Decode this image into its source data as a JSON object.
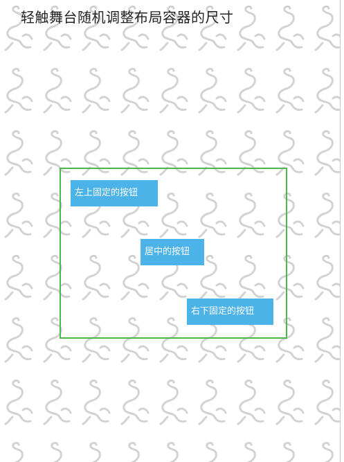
{
  "page": {
    "title": "轻触舞台随机调整布局容器的尺寸"
  },
  "layout": {
    "border_color": "#4cb84c",
    "buttons": {
      "top_left": "左上固定的按钮",
      "center": "居中的按钮",
      "bottom_right": "右下固定的按钮"
    },
    "button_color": "#4cb3e9"
  },
  "background": {
    "pattern_icon": "egret-bird-watermark-icon"
  }
}
